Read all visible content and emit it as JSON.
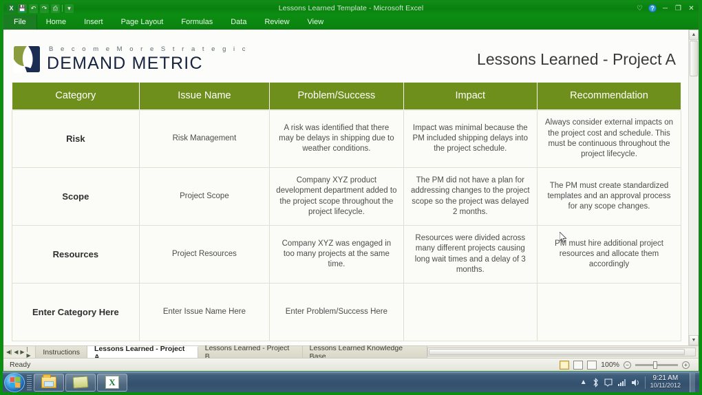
{
  "window": {
    "title": "Lessons Learned Template - Microsoft Excel",
    "quick_access": [
      "save-icon",
      "undo-icon",
      "redo-icon",
      "print-preview-icon",
      "customize-icon"
    ],
    "controls": {
      "collapse_ribbon": "collapse-ribbon-icon",
      "help": "?",
      "minimize": "minimize-icon",
      "restore": "restore-icon",
      "close": "close-icon"
    }
  },
  "ribbon": {
    "tabs": [
      {
        "label": "File",
        "active": true
      },
      {
        "label": "Home",
        "active": false
      },
      {
        "label": "Insert",
        "active": false
      },
      {
        "label": "Page Layout",
        "active": false
      },
      {
        "label": "Formulas",
        "active": false
      },
      {
        "label": "Data",
        "active": false
      },
      {
        "label": "Review",
        "active": false
      },
      {
        "label": "View",
        "active": false
      }
    ]
  },
  "brand": {
    "tagline": "B e c o m e   M o r e   S t r a t e g i c",
    "name": "DEMAND METRIC",
    "mark_colors": {
      "green": "#8b9c3f",
      "navy": "#1b2c52"
    }
  },
  "document": {
    "page_title": "Lessons Learned - Project A",
    "accent_color": "#6f8f1c"
  },
  "table": {
    "headers": [
      "Category",
      "Issue Name",
      "Problem/Success",
      "Impact",
      "Recommendation"
    ],
    "rows": [
      {
        "category": "Risk",
        "issue_name": "Risk Management",
        "problem_success": "A risk was identified that there may be delays in shipping due to weather conditions.",
        "impact": "Impact was minimal because the PM included shipping delays into the project schedule.",
        "recommendation": "Always consider external impacts on the project cost and schedule. This must be continuous throughout the project lifecycle."
      },
      {
        "category": "Scope",
        "issue_name": "Project Scope",
        "problem_success": "Company XYZ product development department added to the project scope throughout the project lifecycle.",
        "impact": "The PM did not have a plan for addressing changes to the project scope so the project was delayed 2 months.",
        "recommendation": "The PM must create standardized templates and an approval process for any scope changes."
      },
      {
        "category": "Resources",
        "issue_name": "Project Resources",
        "problem_success": "Company XYZ was engaged in too many projects at the same time.",
        "impact": "Resources were divided across many different projects causing long wait times and a delay of 3 months.",
        "recommendation": "PM must hire additional project resources and allocate them accordingly"
      },
      {
        "category": "Enter Category Here",
        "issue_name": "Enter Issue Name Here",
        "problem_success": "Enter Problem/Success Here",
        "impact": "",
        "recommendation": ""
      }
    ]
  },
  "sheet_tabs": {
    "nav": [
      "first-sheet-icon",
      "prev-sheet-icon",
      "next-sheet-icon",
      "last-sheet-icon"
    ],
    "items": [
      {
        "label": "Instructions",
        "active": false
      },
      {
        "label": "Lessons Learned - Project A",
        "active": true
      },
      {
        "label": "Lessons Learned - Project B",
        "active": false
      },
      {
        "label": "Lessons Learned Knowledge Base",
        "active": false
      }
    ]
  },
  "status_bar": {
    "state": "Ready",
    "views": [
      "normal-view-icon",
      "page-layout-view-icon",
      "page-break-view-icon"
    ],
    "zoom": "100%",
    "zoom_out": "−",
    "zoom_in": "+"
  },
  "taskbar": {
    "start": "windows-start-orb",
    "items": [
      "windows-explorer-icon",
      "sticky-notes-icon",
      "microsoft-excel-icon"
    ],
    "tray": [
      "show-hidden-icons-icon",
      "bluetooth-icon",
      "action-center-icon",
      "network-icon",
      "volume-icon"
    ],
    "clock_time": "9:21 AM",
    "clock_date": "10/11/2012"
  }
}
